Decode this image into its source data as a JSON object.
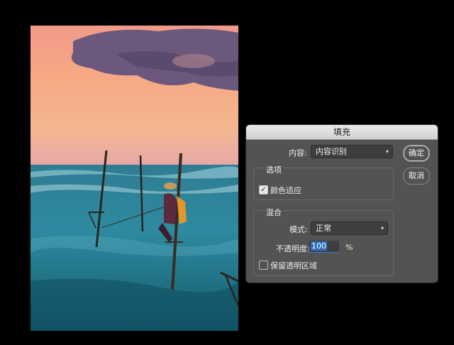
{
  "dialog": {
    "title": "填充",
    "content_label": "内容:",
    "content_value": "内容识别",
    "ok_label": "确定",
    "cancel_label": "取消",
    "options": {
      "title": "选项",
      "color_adapt_label": "颜色适应",
      "color_adapt_checked": true
    },
    "blend": {
      "title": "混合",
      "mode_label": "模式:",
      "mode_value": "正常",
      "opacity_label": "不透明度:",
      "opacity_value": "100",
      "percent": "%",
      "preserve_label": "保留透明区域",
      "preserve_checked": false
    }
  },
  "colors": {
    "dialog_bg": "#535353",
    "accent": "#2f83d6"
  }
}
